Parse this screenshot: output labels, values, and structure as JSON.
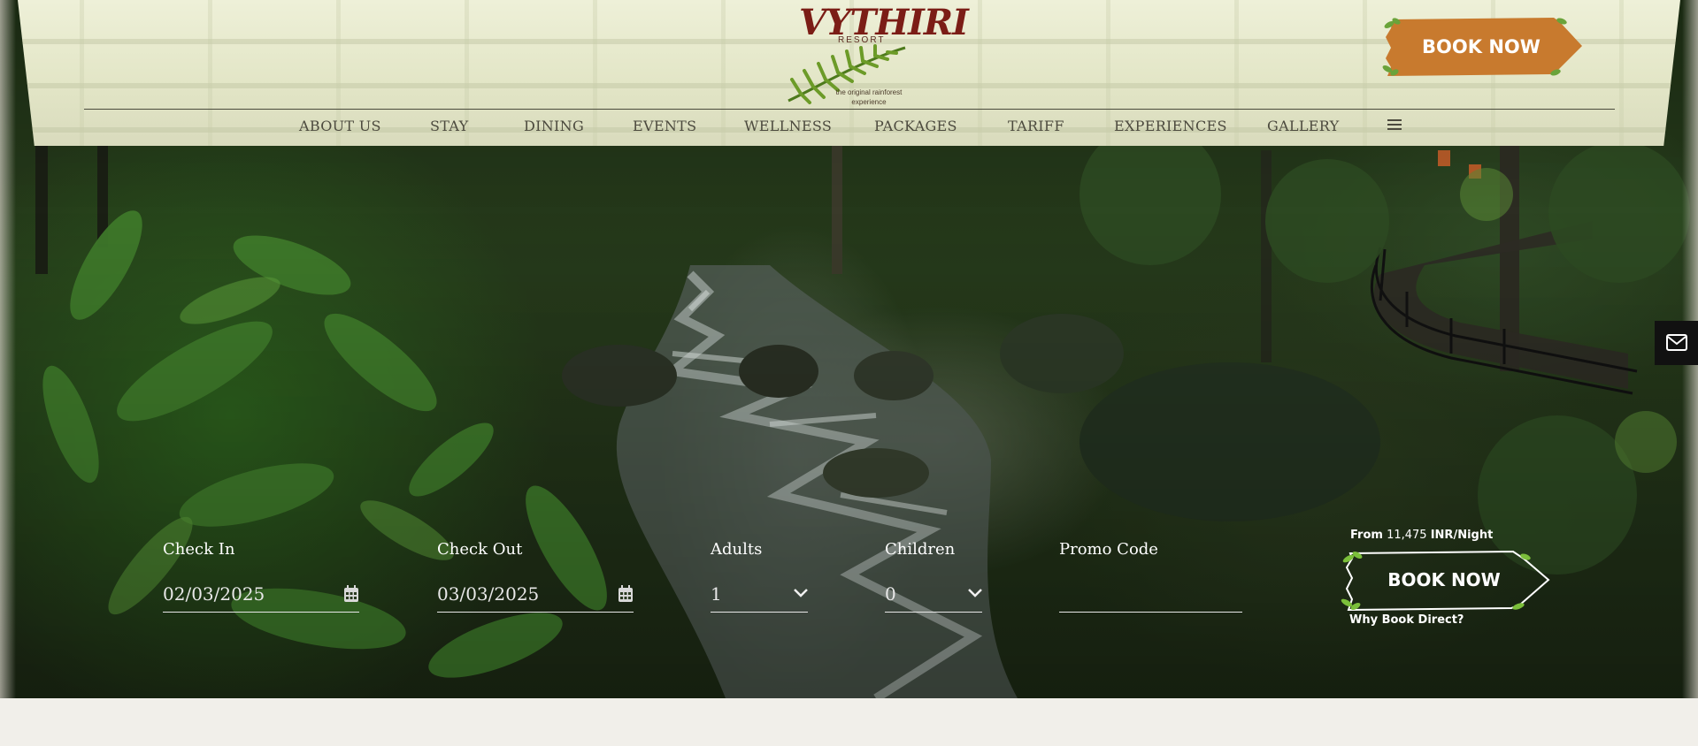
{
  "logo": {
    "word": "VYTHIRI",
    "sub": "RESORT",
    "tagline": "the original rainforest experience"
  },
  "nav": {
    "items": [
      "ABOUT US",
      "STAY",
      "DINING",
      "EVENTS",
      "WELLNESS",
      "PACKAGES",
      "TARIFF",
      "EXPERIENCES",
      "GALLERY"
    ],
    "menu_icon": "hamburger-icon"
  },
  "header_cta": {
    "label": "BOOK NOW",
    "color": "#c87a2e"
  },
  "booking": {
    "check_in": {
      "label": "Check In",
      "value": "02/03/2025",
      "icon": "calendar-icon"
    },
    "check_out": {
      "label": "Check Out",
      "value": "03/03/2025",
      "icon": "calendar-icon"
    },
    "adults": {
      "label": "Adults",
      "value": "1",
      "icon": "chevron-down-icon"
    },
    "children": {
      "label": "Children",
      "value": "0",
      "icon": "chevron-down-icon"
    },
    "promo": {
      "label": "Promo Code",
      "value": ""
    },
    "price_prefix": "From",
    "price": "11,475",
    "price_suffix": "INR/Night",
    "cta": "BOOK NOW",
    "why": "Why Book Direct?"
  },
  "side_tab": {
    "icon": "mail-icon"
  },
  "colors": {
    "accent": "#c87a2e",
    "brand": "#7b1d16",
    "nav_text": "#4c4a3e"
  }
}
